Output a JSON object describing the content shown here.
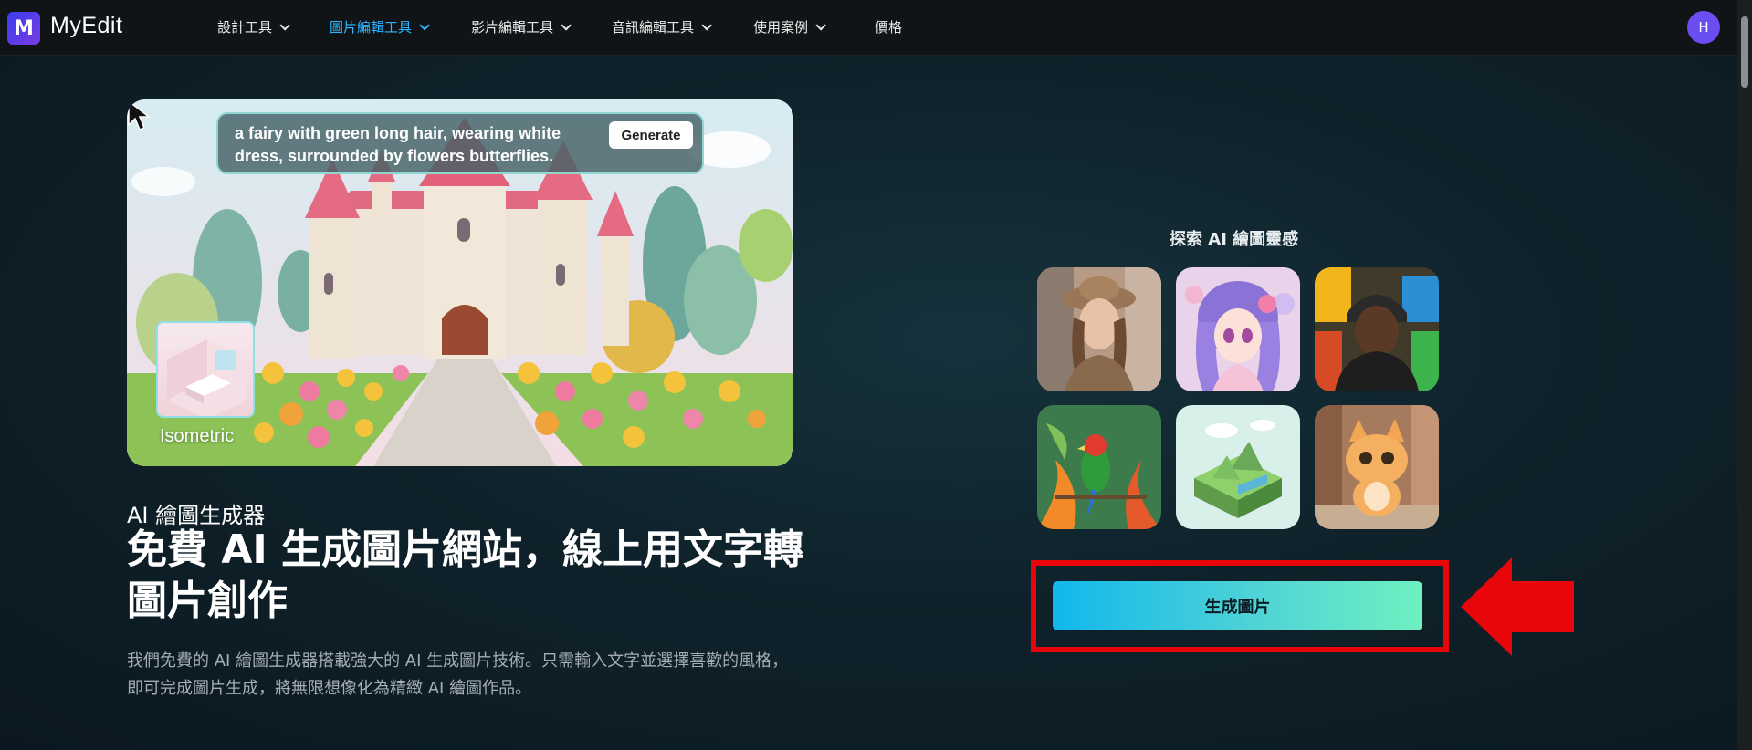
{
  "app": {
    "brand": "MyEdit",
    "logo_letter": "M"
  },
  "nav": {
    "items": [
      {
        "label": "設計工具",
        "has_dropdown": true,
        "active": false
      },
      {
        "label": "圖片編輯工具",
        "has_dropdown": true,
        "active": true
      },
      {
        "label": "影片編輯工具",
        "has_dropdown": true,
        "active": false
      },
      {
        "label": "音訊編輯工具",
        "has_dropdown": true,
        "active": false
      },
      {
        "label": "使用案例",
        "has_dropdown": true,
        "active": false
      },
      {
        "label": "價格",
        "has_dropdown": false,
        "active": false
      }
    ],
    "user_initial": "H"
  },
  "hero_image": {
    "prompt_text": "a fairy with green long hair, wearing white dress, surrounded by flowers butterflies.",
    "generate_label": "Generate",
    "style_label": "Isometric"
  },
  "hero": {
    "eyebrow": "AI 繪圖生成器",
    "headline": "免費 AI 生成圖片網站，線上用文字轉圖片創作",
    "description": "我們免費的 AI 繪圖生成器搭載強大的 AI 生成圖片技術。只需輸入文字並選擇喜歡的風格，即可完成圖片生成，將無限想像化為精緻 AI 繪圖作品。"
  },
  "inspiration": {
    "title": "探索 AI 繪圖靈感",
    "tiles": [
      "woman-portrait",
      "anime-girl",
      "graffiti-man",
      "parrot",
      "isometric-landscape",
      "cartoon-cat"
    ]
  },
  "cta": {
    "label": "生成圖片"
  },
  "colors": {
    "accent": "#2fb4ff",
    "highlight": "#e8060b",
    "avatar": "#6b4ef0"
  }
}
